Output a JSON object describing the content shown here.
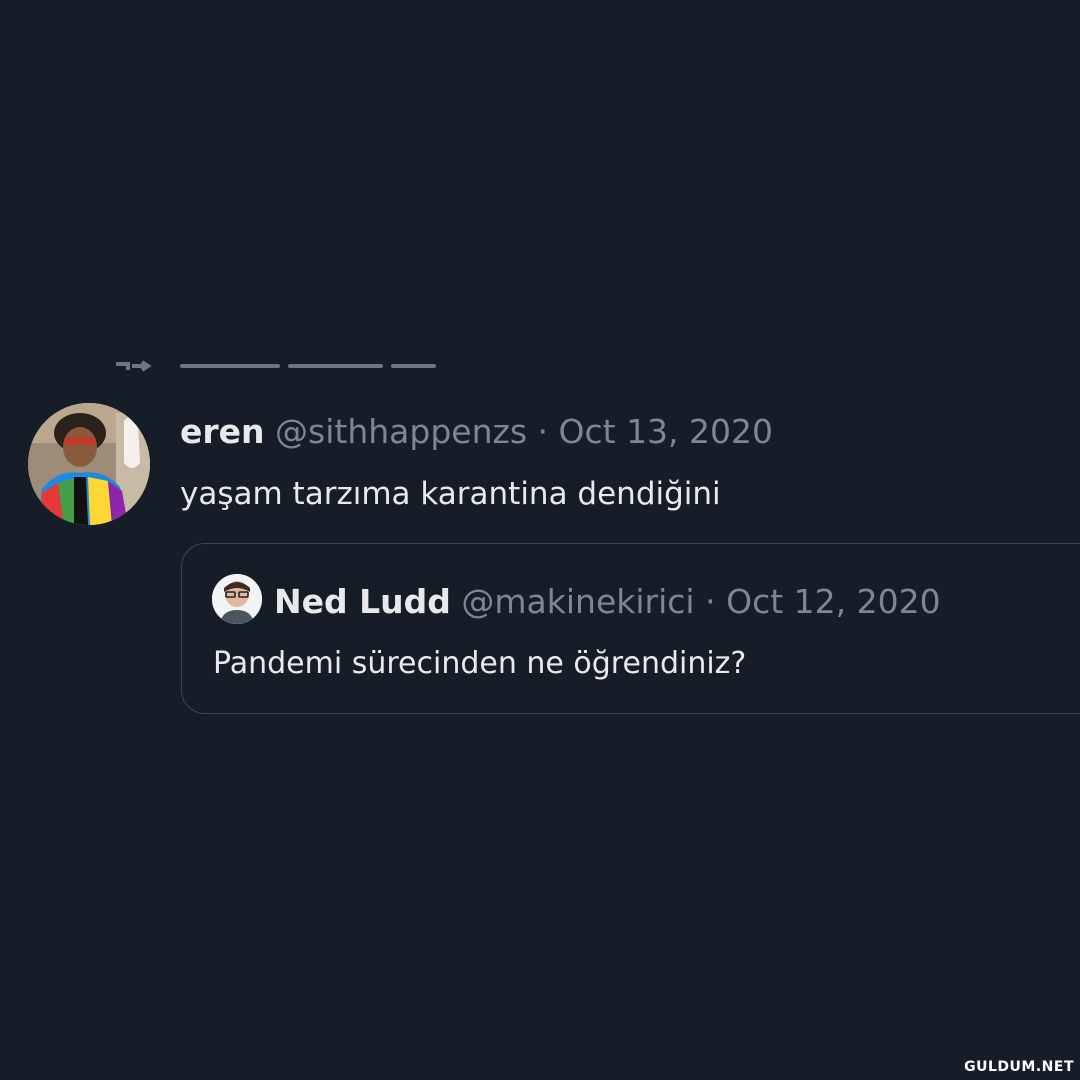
{
  "tweet": {
    "author_name": "eren",
    "author_handle": "@sithhappenzs",
    "separator": "·",
    "date": "Oct 13, 2020",
    "text": "yaşam tarzıma karantina dendiğini",
    "avatar_icon": "profile-photo-avatar"
  },
  "quoted_tweet": {
    "author_name": "Ned Ludd",
    "author_handle": "@makinekirici",
    "separator": "·",
    "date": "Oct 12, 2020",
    "text": "Pandemi sürecinden ne öğrendiniz?",
    "avatar_icon": "profile-photo-avatar"
  },
  "watermark": "GULDUM.NET",
  "colors": {
    "background": "#161d27",
    "primary_text": "#e7e9ea",
    "muted_text": "#7d8790",
    "quote_border": "#3c4650"
  }
}
